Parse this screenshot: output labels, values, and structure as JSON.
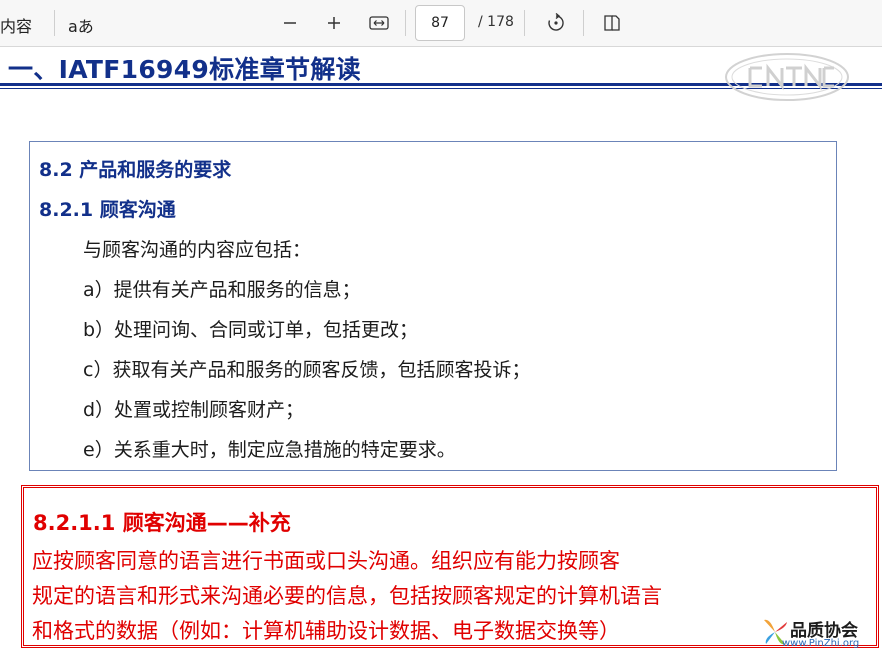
{
  "toolbar": {
    "contents_label": "内容",
    "read_aloud_label": "aあ",
    "page_current": "87",
    "page_total": "/ 178"
  },
  "slide": {
    "title": "一、IATF16949标准章节解读",
    "box1": {
      "heading1": "8.2  产品和服务的要求",
      "heading2": "8.2.1  顾客沟通",
      "intro": "与顾客沟通的内容应包括：",
      "items": [
        "a）提供有关产品和服务的信息；",
        "b）处理问询、合同或订单，包括更改；",
        "c）获取有关产品和服务的顾客反馈，包括顾客投诉；",
        "d）处置或控制顾客财产；",
        "e）关系重大时，制定应急措施的特定要求。"
      ]
    },
    "box2": {
      "heading": "8.2.1.1 顾客沟通——补充",
      "lines": [
        "    应按顾客同意的语言进行书面或口头沟通。组织应有能力按顾客",
        "规定的语言和形式来沟通必要的信息，包括按顾客规定的计算机语言",
        "和格式的数据（例如：计算机辅助设计数据、电子数据交换等）"
      ]
    },
    "logo": {
      "brand": "品质协会",
      "url": "www.PinZhi.org"
    }
  },
  "colors": {
    "title_blue": "#12308a",
    "emphasis_red": "#e00000",
    "box_border": "#6b84b8"
  }
}
